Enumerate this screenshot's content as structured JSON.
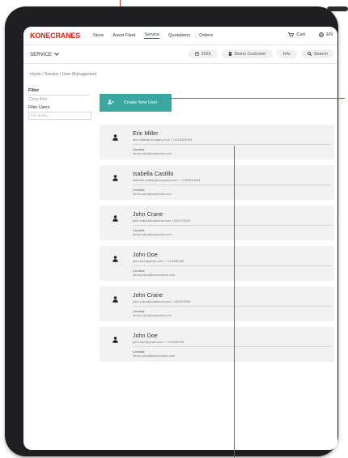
{
  "brand": {
    "logo_text": "KONECRANES",
    "accent_color": "#e2231a",
    "teal_color": "#3aa7a1"
  },
  "topnav": {
    "items": [
      {
        "label": "Store",
        "active": false
      },
      {
        "label": "Asset Fleet",
        "active": false
      },
      {
        "label": "Service",
        "active": true
      },
      {
        "label": "Quotations",
        "active": false
      },
      {
        "label": "Orders",
        "active": false
      }
    ],
    "cart_label": "Cart",
    "lang_label": "EN"
  },
  "subbar": {
    "service_label": "SERVICE",
    "year_label": "2025",
    "customer_label": "Demo Customer",
    "info_label": "Info",
    "search_label": "Search"
  },
  "breadcrumb": "Home / Service / User Management",
  "filter": {
    "title": "Filter",
    "clear_label": "Clear filter",
    "users_label": "Filter Users",
    "input_placeholder": "Full query..."
  },
  "create_button_label": "Create New User",
  "users": [
    {
      "name": "Eric Miller",
      "contact": "eric.miller@company.com / +1123456789",
      "created_label": "Created:",
      "created_by": "demo.user@customer.com"
    },
    {
      "name": "Isabella Castillo",
      "contact": "isabella.castillo@company.com / +1234544454",
      "created_label": "Created:",
      "created_by": "demo.user@customer.com"
    },
    {
      "name": "John Crane",
      "contact": "john.crane@customer.com / 040123459",
      "created_label": "Created:",
      "created_by": "demo.user@customer.com"
    },
    {
      "name": "John Doe",
      "contact": "john.doe@gmail.com / +123456789",
      "created_label": "Created:",
      "created_by": "demo.user@konecranes.com"
    },
    {
      "name": "John Crane",
      "contact": "john.crane@customer.com / 040123459",
      "created_label": "Created:",
      "created_by": "demo.user@customer.com"
    },
    {
      "name": "John Doe",
      "contact": "john.doe@gmail.com / +123456789",
      "created_label": "Created:",
      "created_by": "demo.user@konecranes.com"
    }
  ]
}
